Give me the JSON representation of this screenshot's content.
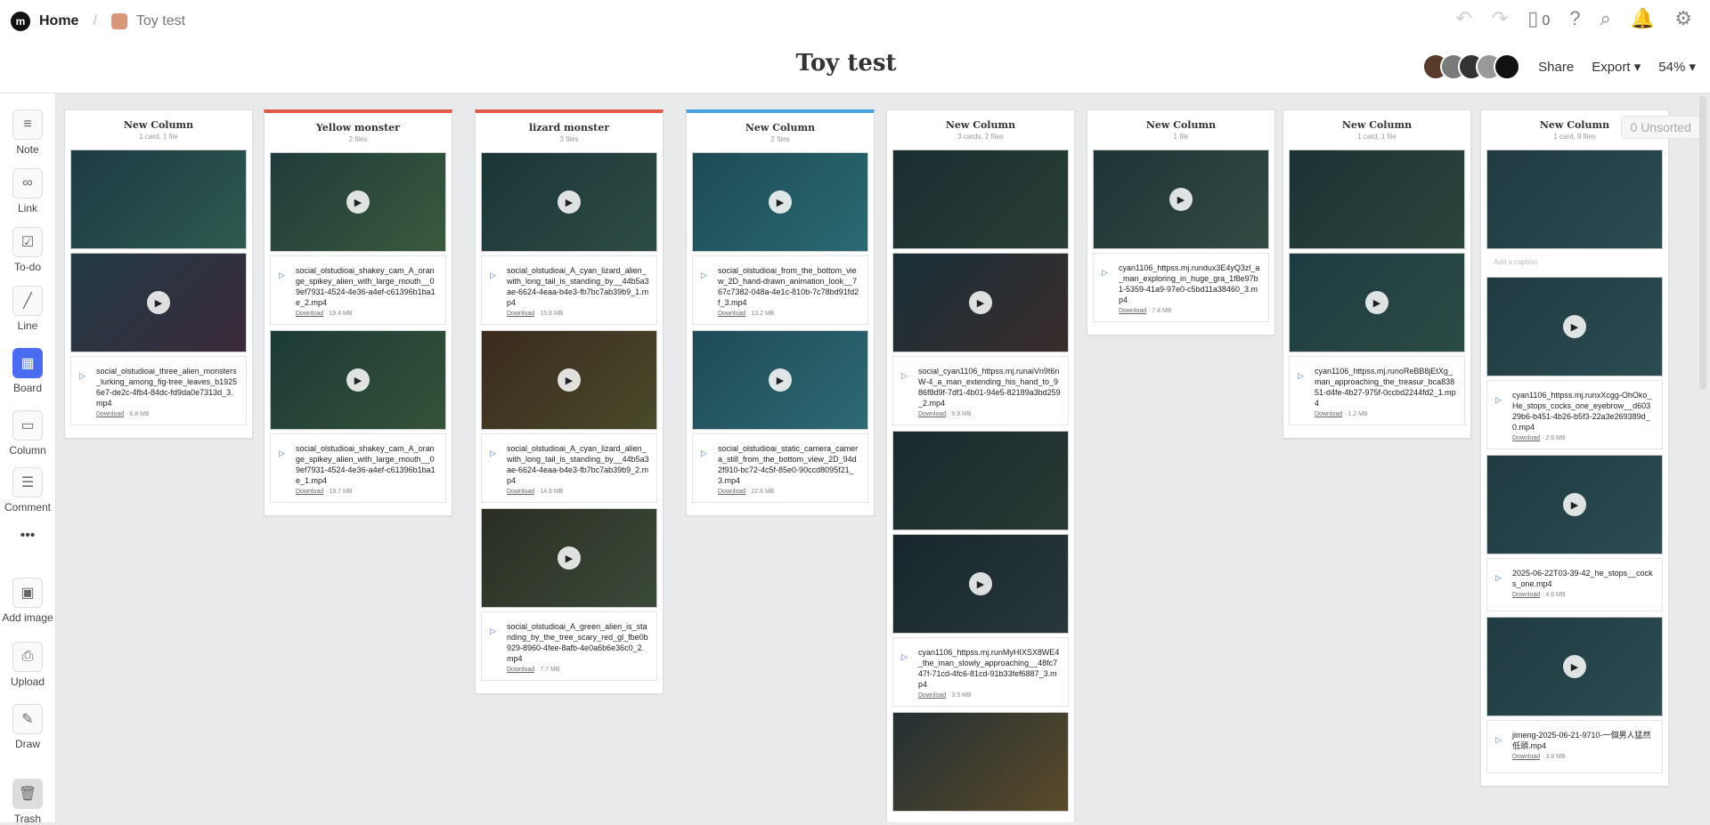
{
  "breadcrumb": {
    "home": "Home",
    "board": "Toy test"
  },
  "title": "Toy test",
  "header": {
    "device_count": "0",
    "share": "Share",
    "export": "Export",
    "zoom": "54%",
    "unsorted": "0 Unsorted"
  },
  "toolbar": [
    "Note",
    "Link",
    "To-do",
    "Line",
    "Board",
    "Column",
    "Comment",
    "Add image",
    "Upload",
    "Draw",
    "Trash"
  ],
  "columns": [
    {
      "title": "New Column",
      "sub": "1 card, 1 file",
      "accent": "",
      "items": [
        {
          "type": "thumb",
          "tone": [
            "#1d3a44",
            "#2e5a4e"
          ],
          "play": false
        },
        {
          "type": "thumb",
          "tone": [
            "#223a44",
            "#3b2a3a"
          ],
          "play": true
        },
        {
          "type": "file",
          "name": "social_olstudioai_three_alien_monsters_lurking_among_fig-tree_leaves_b19256e7-de2c-4fb4-84dc-fd9da0e7313d_3.mp4",
          "size": "6.8 MB"
        }
      ]
    },
    {
      "title": "Yellow monster",
      "sub": "2 files",
      "accent": "#e05a4a",
      "items": [
        {
          "type": "thumb",
          "tone": [
            "#1f3b3a",
            "#3a5a3e"
          ],
          "play": true
        },
        {
          "type": "file",
          "name": "social_olstudioai_shakey_cam_A_orange_spikey_alien_with_large_mouth__09ef7931-4524-4e36-a4ef-c61396b1ba1e_2.mp4",
          "size": "19.4 MB"
        },
        {
          "type": "thumb",
          "tone": [
            "#1c3a36",
            "#35523a"
          ],
          "play": true
        },
        {
          "type": "file",
          "name": "social_olstudioai_shakey_cam_A_orange_spikey_alien_with_large_mouth__09ef7931-4524-4e36-a4ef-c61396b1ba1e_1.mp4",
          "size": "19.7 MB"
        }
      ]
    },
    {
      "title": "lizard monster",
      "sub": "3 files",
      "accent": "#e05a4a",
      "items": [
        {
          "type": "thumb",
          "tone": [
            "#1b3536",
            "#2e4c46"
          ],
          "play": true
        },
        {
          "type": "file",
          "name": "social_olstudioai_A_cyan_lizard_alien_with_long_tail_is_standing_by__44b5a3ae-6624-4eaa-b4e3-fb7bc7ab39b9_1.mp4",
          "size": "15.8 MB"
        },
        {
          "type": "thumb",
          "tone": [
            "#3a2a1e",
            "#4a4a2a"
          ],
          "play": true
        },
        {
          "type": "file",
          "name": "social_olstudioai_A_cyan_lizard_alien_with_long_tail_is_standing_by__44b5a3ae-6624-4eaa-b4e3-fb7bc7ab39b9_2.mp4",
          "size": "14.6 MB"
        },
        {
          "type": "thumb",
          "tone": [
            "#2a2e22",
            "#3c4a3a"
          ],
          "play": true
        },
        {
          "type": "file",
          "name": "social_olstudioai_A_green_alien_is_standing_by_the_tree_scary_red_gl_fbe0b929-8960-4fee-8afb-4e0a6b6e36c0_2.mp4",
          "size": "7.7 MB"
        }
      ]
    },
    {
      "title": "New Column",
      "sub": "2 files",
      "accent": "#4aa3e0",
      "items": [
        {
          "type": "thumb",
          "tone": [
            "#1e4a56",
            "#2a6a72"
          ],
          "play": true
        },
        {
          "type": "file",
          "name": "social_olstudioai_from_the_bottom_view_2D_hand-drawn_animation_look__767c7382-048a-4e1c-810b-7c78bd91fd2f_3.mp4",
          "size": "13.2 MB"
        },
        {
          "type": "thumb",
          "tone": [
            "#1e4a56",
            "#2e6a74"
          ],
          "play": true
        },
        {
          "type": "file",
          "name": "social_olstudioai_static_camera_camera_still_from_the_bottom_view_2D_94d2f910-bc72-4c5f-85e0-90ccd8095f21_3.mp4",
          "size": "22.6 MB"
        }
      ]
    },
    {
      "title": "New Column",
      "sub": "3 cards, 2 files",
      "accent": "",
      "items": [
        {
          "type": "thumb",
          "tone": [
            "#1a2e32",
            "#2a3e36"
          ],
          "play": false
        },
        {
          "type": "thumb",
          "tone": [
            "#1a3038",
            "#3a2c2c"
          ],
          "play": true
        },
        {
          "type": "file",
          "name": "social_cyan1106_httpss.mj.runaiVn9t6nW-4_a_man_extending_his_hand_to_986f8d9f-7df1-4b01-94e5-82189a3bd259_2.mp4",
          "size": "9.9 MB"
        },
        {
          "type": "thumb",
          "tone": [
            "#182a2e",
            "#2a3a34"
          ],
          "play": false
        },
        {
          "type": "thumb",
          "tone": [
            "#16262c",
            "#28383a"
          ],
          "play": true
        },
        {
          "type": "file",
          "name": "cyan1106_httpss.mj.runMyHIXSX8WE4_the_man_slowly_approaching__48fc747f-71cd-4fc6-81cd-91b33fef6887_3.mp4",
          "size": "3.5 MB"
        },
        {
          "type": "thumb",
          "tone": [
            "#243034",
            "#5a4a2a"
          ],
          "play": false
        }
      ]
    },
    {
      "title": "New Column",
      "sub": "1 file",
      "accent": "",
      "items": [
        {
          "type": "thumb",
          "tone": [
            "#1e3436",
            "#344a44"
          ],
          "play": true
        },
        {
          "type": "file",
          "name": "cyan1106_httpss.mj.rundux3E4yQ3zl_a_man_exploring_in_huge_gra_1f8e97b1-5359-41a9-97e0-c5bd11a38460_3.mp4",
          "size": "7.4 MB"
        }
      ]
    },
    {
      "title": "New Column",
      "sub": "1 card, 1 file",
      "accent": "",
      "items": [
        {
          "type": "thumb",
          "tone": [
            "#1c3234",
            "#2c443c"
          ],
          "play": false
        },
        {
          "type": "thumb",
          "tone": [
            "#1e3c40",
            "#2c4a44"
          ],
          "play": true
        },
        {
          "type": "file",
          "name": "cyan1106_httpss.mj.runoReBB8jEtXg_man_approaching_the_treasur_bca83851-d4fe-4b27-975f-0ccbd2244fd2_1.mp4",
          "size": "1.2 MB"
        }
      ]
    },
    {
      "title": "New Column",
      "sub": "1 card, 9 files",
      "accent": "",
      "items": [
        {
          "type": "thumb",
          "tone": [
            "#203a42",
            "#2c4c52"
          ],
          "play": false
        },
        {
          "type": "caption",
          "text": "Add a caption"
        },
        {
          "type": "thumb",
          "tone": [
            "#203a42",
            "#2c4c52"
          ],
          "play": true
        },
        {
          "type": "file",
          "name": "cyan1106_httpss.mj.runxXcgg-OhOko_He_stops_cocks_one_eyebrow__d60329b6-b451-4b26-b5f3-22a3e269389d_0.mp4",
          "size": "2.6 MB"
        },
        {
          "type": "thumb",
          "tone": [
            "#203a42",
            "#2c4c52"
          ],
          "play": true
        },
        {
          "type": "file",
          "name": "2025-06-22T03-39-42_he_stops__cocks_one.mp4",
          "size": "4.6 MB"
        },
        {
          "type": "thumb",
          "tone": [
            "#203a42",
            "#2c4c52"
          ],
          "play": true
        },
        {
          "type": "file",
          "name": "jimeng-2025-06-21-9710-一個男人猛然低頭.mp4",
          "size": "3.9 MB"
        }
      ]
    }
  ],
  "download_label": "Download"
}
